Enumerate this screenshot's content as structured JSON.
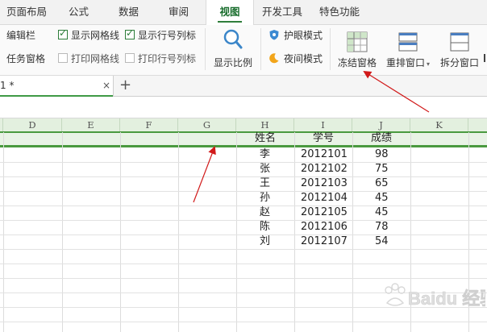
{
  "menu": {
    "tabs": [
      {
        "label": "页面布局",
        "active": false
      },
      {
        "label": "公式",
        "active": false
      },
      {
        "label": "数据",
        "active": false
      },
      {
        "label": "审阅",
        "active": false
      },
      {
        "label": "视图",
        "active": true
      },
      {
        "label": "开发工具",
        "active": false
      },
      {
        "label": "特色功能",
        "active": false
      }
    ]
  },
  "ribbon": {
    "edit_bar": "编辑栏",
    "task_pane": "任务窗格",
    "show_gridlines": "显示网格线",
    "show_row_col_headers": "显示行号列标",
    "print_gridlines": "打印网格线",
    "print_row_col_headers": "打印行号列标",
    "zoom": "显示比例",
    "eye_protection": "护眼模式",
    "night_mode": "夜间模式",
    "freeze_panes": "冻结窗格",
    "arrange_windows": "重排窗口",
    "split_window": "拆分窗口"
  },
  "sheet_tab": {
    "name": "1 *",
    "close": "×",
    "add": "+"
  },
  "grid": {
    "columns": [
      "D",
      "E",
      "F",
      "G",
      "H",
      "I",
      "J",
      "K"
    ],
    "headers": {
      "name": "姓名",
      "id": "学号",
      "score": "成绩"
    },
    "rows": [
      {
        "name": "李",
        "id": "2012101",
        "score": "98"
      },
      {
        "name": "张",
        "id": "2012102",
        "score": "75"
      },
      {
        "name": "王",
        "id": "2012103",
        "score": "65"
      },
      {
        "name": "孙",
        "id": "2012104",
        "score": "45"
      },
      {
        "name": "赵",
        "id": "2012105",
        "score": "45"
      },
      {
        "name": "陈",
        "id": "2012106",
        "score": "78"
      },
      {
        "name": "刘",
        "id": "2012107",
        "score": "54"
      }
    ]
  },
  "watermark": "Baidu 经验",
  "colors": {
    "accent": "#2f7d3b",
    "freeze_line": "#4a9a3f",
    "arrow": "#d11a1a",
    "header_bg": "#e3f0df"
  }
}
